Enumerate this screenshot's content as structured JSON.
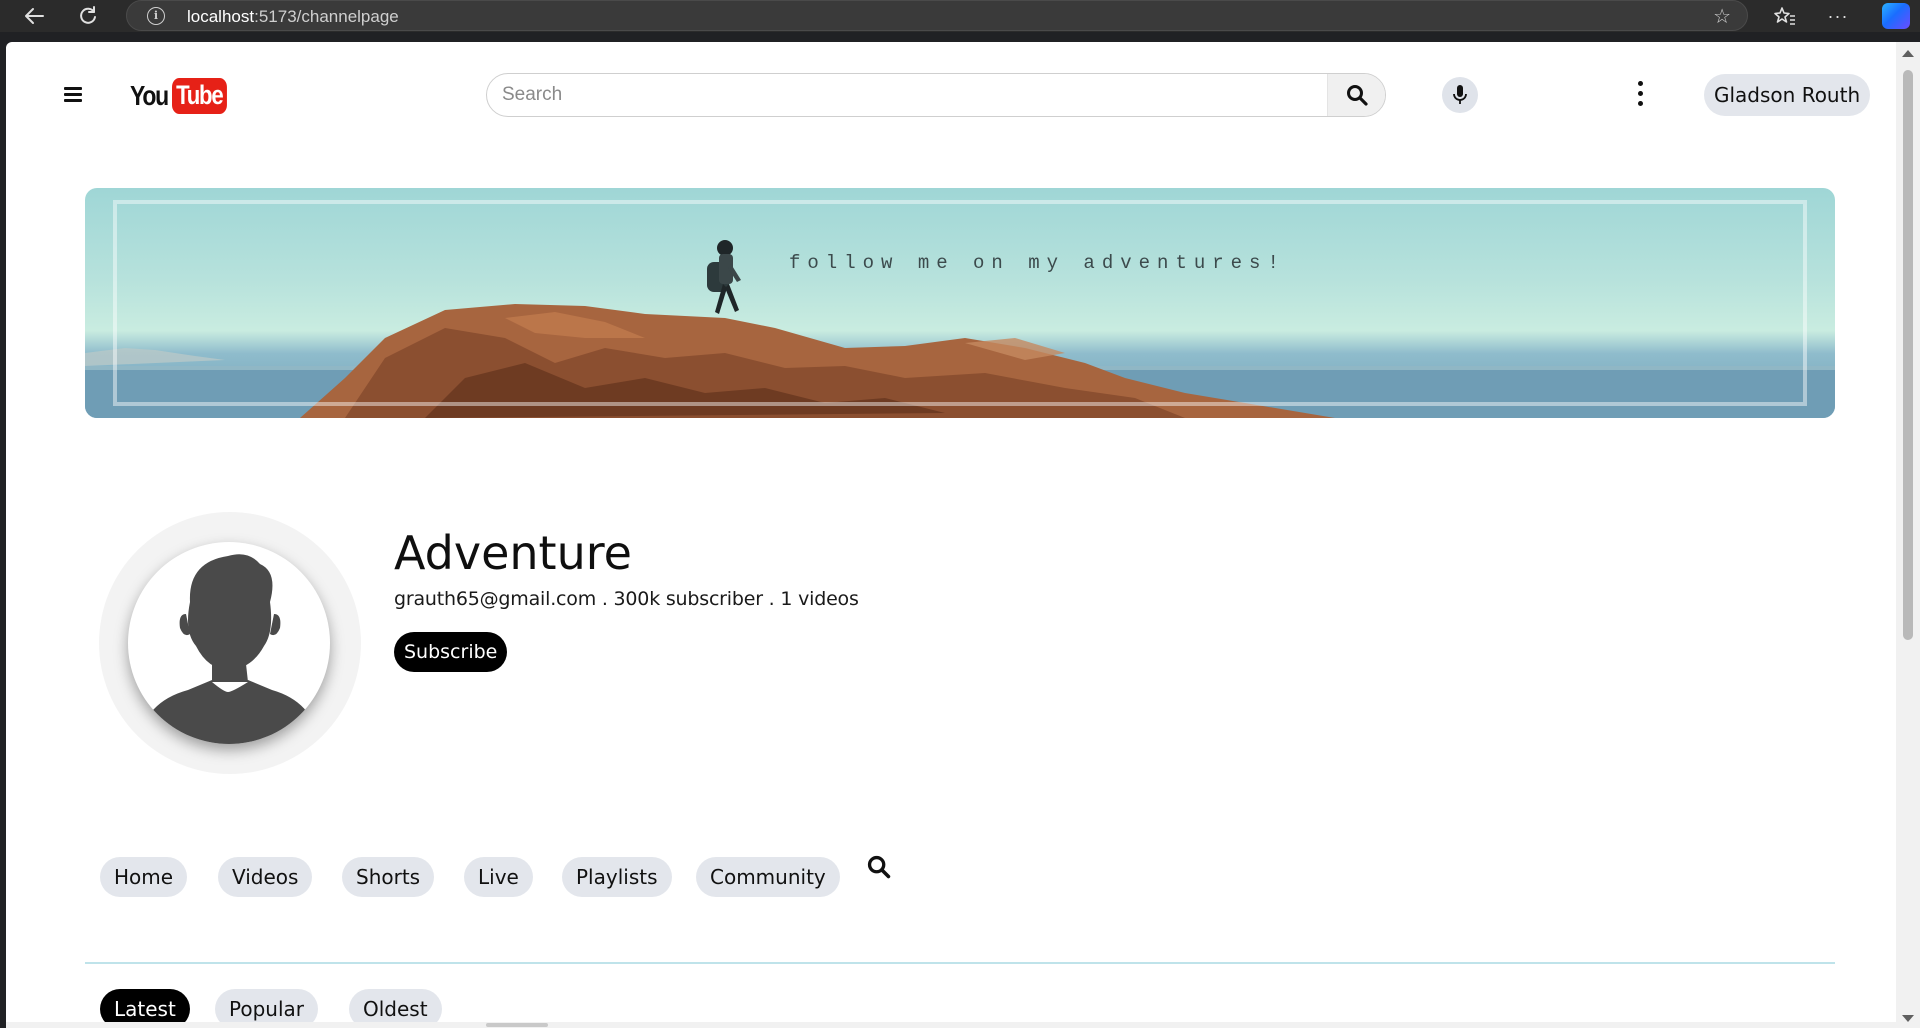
{
  "browser": {
    "url_host": "localhost",
    "url_path": ":5173/channelpage"
  },
  "header": {
    "logo_you": "You",
    "logo_tube": "Tube",
    "search_placeholder": "Search",
    "user_name": "Gladson Routh"
  },
  "banner": {
    "tagline": "follow me on my adventures!"
  },
  "channel": {
    "name": "Adventure",
    "meta": "grauth65@gmail.com . 300k subscriber . 1 videos",
    "subscribe_label": "Subscribe"
  },
  "tabs": [
    "Home",
    "Videos",
    "Shorts",
    "Live",
    "Playlists",
    "Community"
  ],
  "sort": {
    "options": [
      "Latest",
      "Popular",
      "Oldest"
    ],
    "active": "Latest"
  },
  "colors": {
    "brand_red": "#e62117",
    "chip_bg": "#e3e6ec",
    "active_chip": "#000000",
    "divider": "#bfe3ea"
  }
}
